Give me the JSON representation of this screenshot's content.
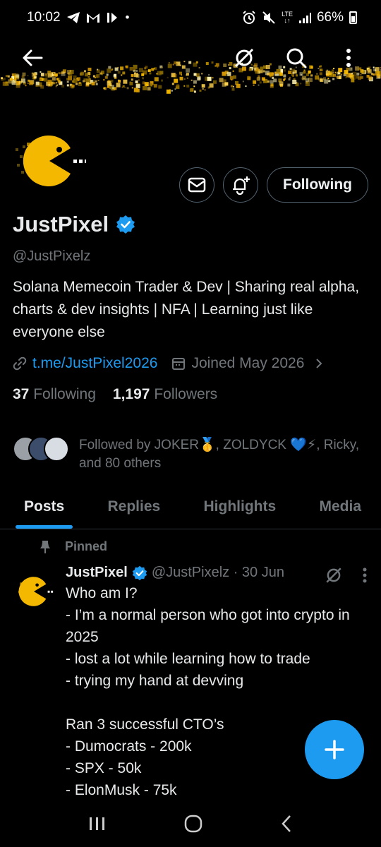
{
  "status_bar": {
    "time": "10:02",
    "battery_pct": "66%",
    "net_label": "LTE",
    "left_icons": [
      "telegram-icon",
      "gmail-icon",
      "media-icon",
      "dot-icon"
    ],
    "right_icons": [
      "alarm-icon",
      "mute-icon",
      "lte-icon",
      "signal-icon",
      "battery-icon"
    ]
  },
  "nav": {
    "back_icon": "arrow-left-icon",
    "icons": [
      "grok-icon",
      "search-icon",
      "more-icon"
    ]
  },
  "profile": {
    "display_name": "JustPixel",
    "verified": true,
    "handle": "@JustPixelz",
    "bio": "Solana Memecoin Trader & Dev | Sharing real alpha, charts & dev insights | NFA | Learning just like everyone else",
    "link": "t.me/JustPixel2026",
    "joined": "Joined May 2026",
    "following_count": "37",
    "following_label": "Following",
    "followers_count": "1,197",
    "followers_label": "Followers",
    "follow_button": "Following",
    "followed_by": "Followed by JOKER🥇, ZOLDYCK 💙⚡, Ricky, and 80 others"
  },
  "tabs": [
    {
      "label": "Posts",
      "active": true
    },
    {
      "label": "Replies",
      "active": false
    },
    {
      "label": "Highlights",
      "active": false
    },
    {
      "label": "Media",
      "active": false
    }
  ],
  "post": {
    "pinned_label": "Pinned",
    "name": "JustPixel",
    "handle_time": "@JustPixelz · 30 Jun",
    "body": "Who am I?\n- I’m a normal person who got into crypto in   2025\n- lost a lot while learning how to trade\n- trying my hand at devving\n\nRan 3 successful CTO’s\n- Dumocrats - 200k\n- SPX - 50k\n- ElonMusk - 75k"
  },
  "colors": {
    "accent": "#1d9bf0",
    "pacman": "#f5b800",
    "muted": "#71767b"
  }
}
